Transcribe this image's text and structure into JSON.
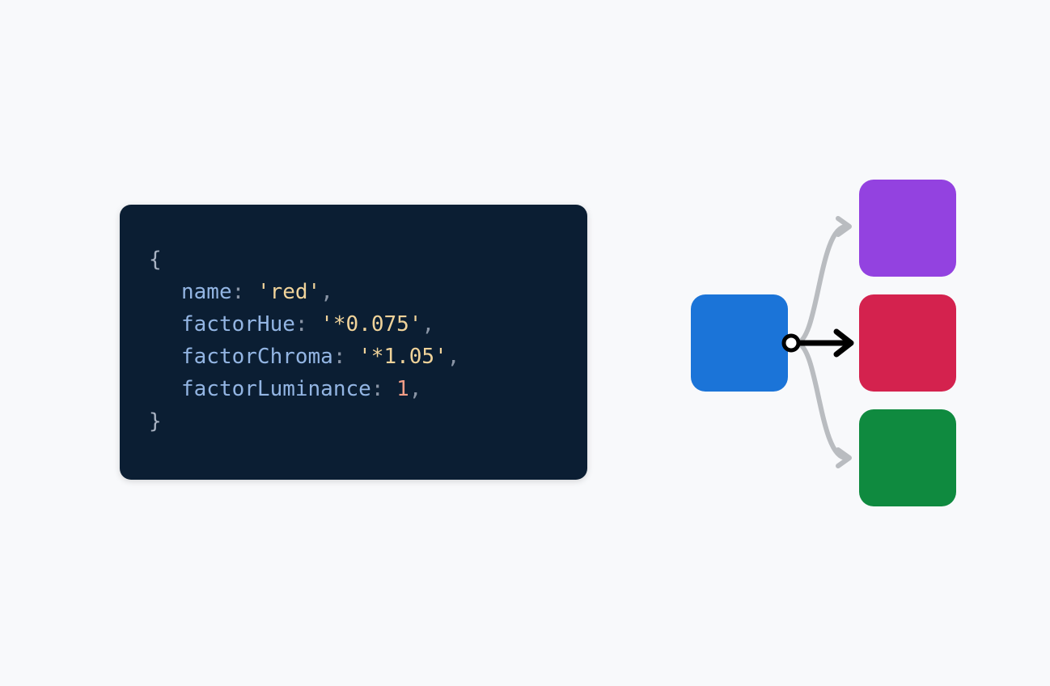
{
  "code": {
    "open_brace": "{",
    "close_brace": "}",
    "line1": {
      "key": "name",
      "colon": ": ",
      "value": "'red'",
      "comma": ","
    },
    "line2": {
      "key": "factorHue",
      "colon": ": ",
      "value": "'*0.075'",
      "comma": ","
    },
    "line3": {
      "key": "factorChroma",
      "colon": ": ",
      "value": "'*1.05'",
      "comma": ","
    },
    "line4": {
      "key": "factorLuminance",
      "colon": ": ",
      "value": "1",
      "comma": ","
    }
  },
  "colors": {
    "code_bg": "#0b1e33",
    "source": "#1b74d8",
    "purple": "#9342e0",
    "red": "#d4224e",
    "green": "#0f8a3f",
    "arrow_gray": "#b9bcc0",
    "arrow_black": "#000000"
  }
}
